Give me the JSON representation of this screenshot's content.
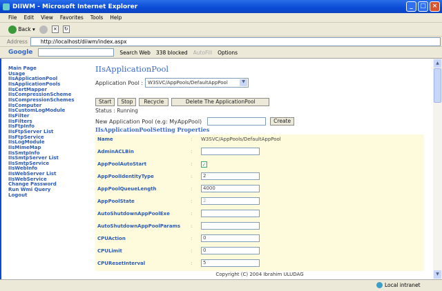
{
  "window": {
    "title": "DIIWM - Microsoft Internet Explorer"
  },
  "menu": [
    "File",
    "Edit",
    "View",
    "Favorites",
    "Tools",
    "Help"
  ],
  "toolbar": {
    "back": "Back"
  },
  "address": {
    "label": "Address",
    "url": "http://localhost/diiwm/index.aspx"
  },
  "google": {
    "logo": "Google",
    "search_web": "Search Web",
    "blocked": "338 blocked",
    "autofill": "AutoFill",
    "options": "Options"
  },
  "sidebar": [
    "Main Page",
    "Usage",
    "IIsApplicationPool",
    "IIsApplicationPools",
    "IIsCertMapper",
    "IIsCompressionScheme",
    "IIsCompressionSchemes",
    "IIsComputer",
    "IIsCustomLogModule",
    "IIsFilter",
    "IIsFilters",
    "IIsFtpInfo",
    "IIsFtpServer List",
    "IIsFtpService",
    "IIsLogModule",
    "IIsMimeMap",
    "IIsSmtpInfo",
    "IIsSmtpServer List",
    "IIsSmtpService",
    "IIsWebInfo",
    "IIsWebServer List",
    "IIsWebService",
    "Change Password",
    "Run Wmi Query",
    "Logout"
  ],
  "main": {
    "title": "IIsApplicationPool",
    "pool_label": "Application Pool :",
    "pool_value": "W3SVC/AppPools/DefaultAppPool",
    "buttons": {
      "start": "Start",
      "stop": "Stop",
      "recycle": "Recycle",
      "delete": "Delete The ApplicationPool",
      "create": "Create"
    },
    "status": "Status : Running",
    "new_pool_label": "New Application Pool (e.g: MyAppPool)",
    "props_title": "IIsApplicationPoolSetting Properties",
    "props": [
      {
        "key": "Name",
        "type": "text",
        "value": "W3SVC/AppPools/DefaultAppPool"
      },
      {
        "key": "AdminACLBin",
        "type": "input",
        "value": ""
      },
      {
        "key": "AppPoolAutoStart",
        "type": "check",
        "value": "✓"
      },
      {
        "key": "AppPoolIdentityType",
        "type": "input",
        "value": "2"
      },
      {
        "key": "AppPoolQueueLength",
        "type": "input",
        "value": "4000"
      },
      {
        "key": "AppPoolState",
        "type": "disabled",
        "value": "2"
      },
      {
        "key": "AutoShutdownAppPoolExe",
        "type": "input",
        "value": ""
      },
      {
        "key": "AutoShutdownAppPoolParams",
        "type": "input",
        "value": ""
      },
      {
        "key": "CPUAction",
        "type": "input",
        "value": "0"
      },
      {
        "key": "CPULimit",
        "type": "input",
        "value": "0"
      },
      {
        "key": "CPUResetInterval",
        "type": "input",
        "value": "5"
      }
    ],
    "separator": ":",
    "copyright": "Copyright (C) 2004 Ibrahim ULUDAG"
  },
  "statusbar": {
    "zone": "Local intranet"
  }
}
